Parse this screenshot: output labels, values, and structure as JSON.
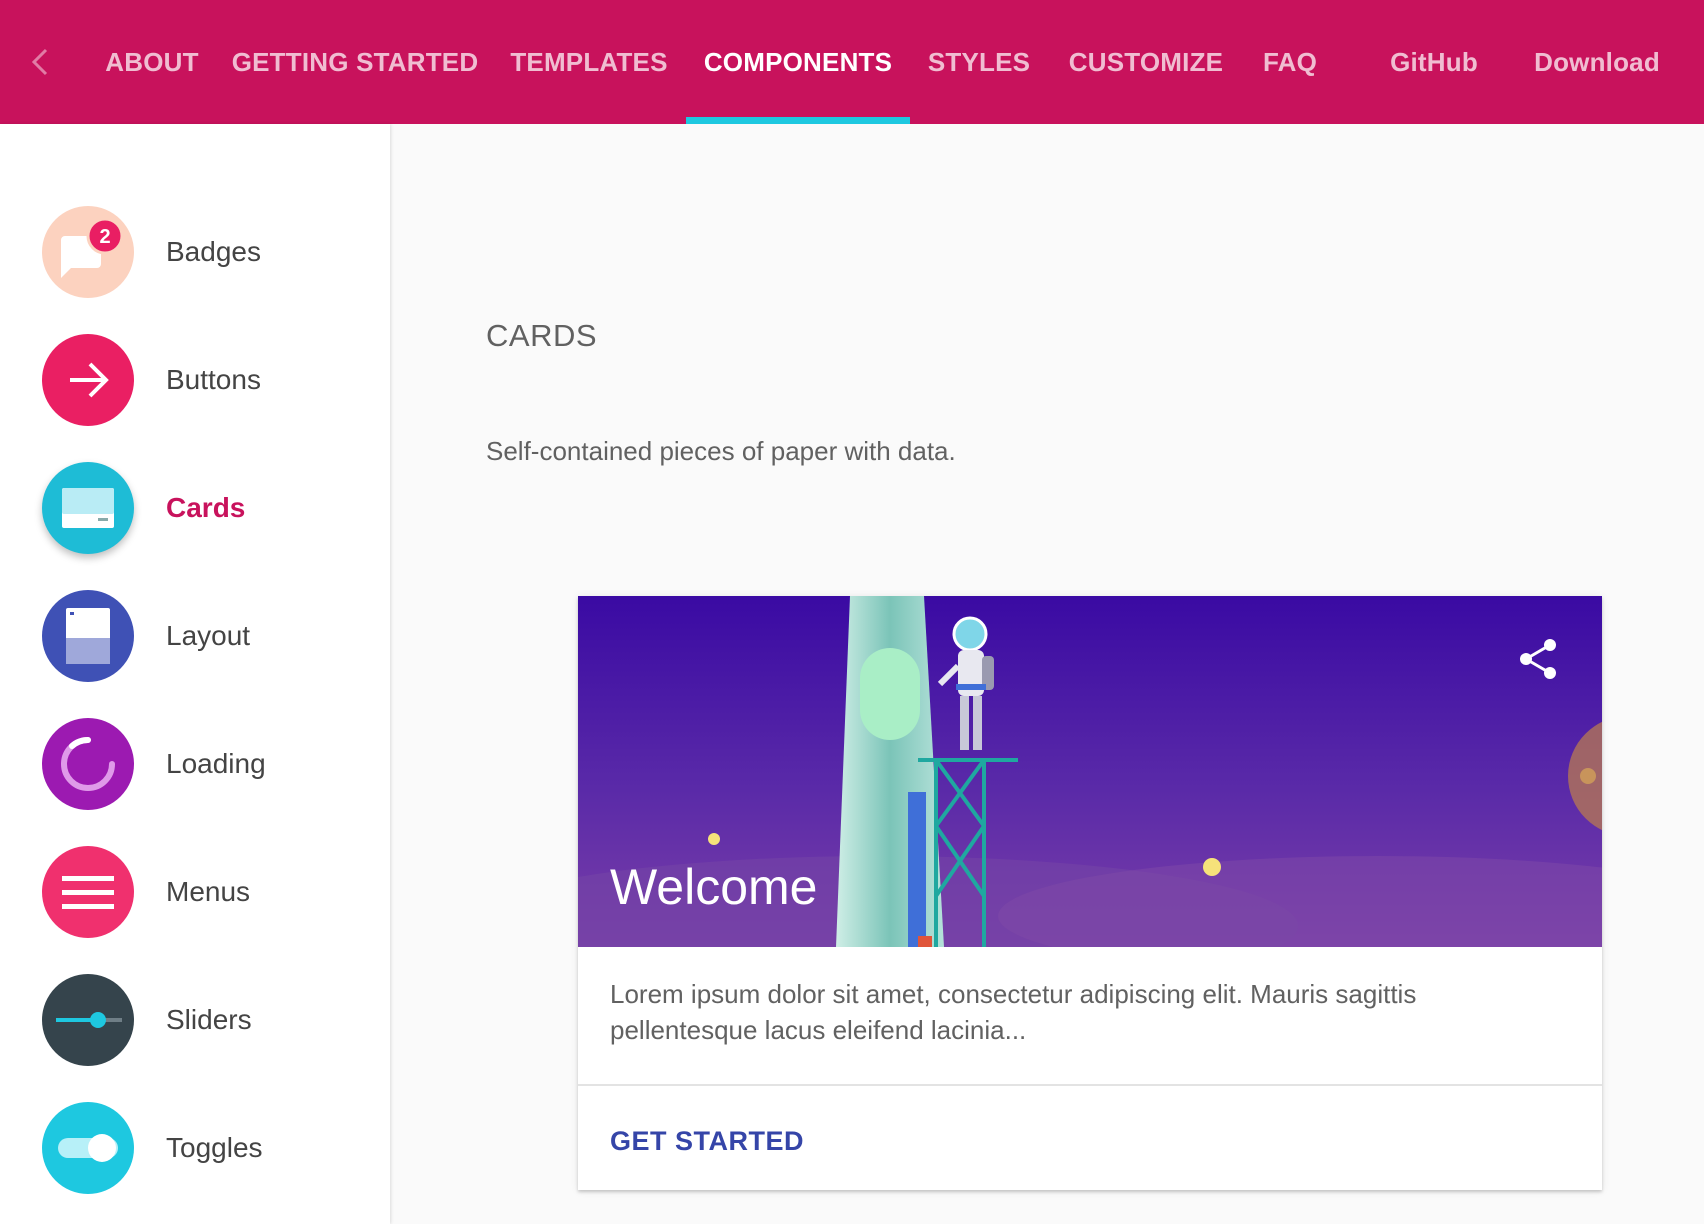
{
  "nav": {
    "items": [
      {
        "label": "ABOUT",
        "active": false
      },
      {
        "label": "GETTING STARTED",
        "active": false
      },
      {
        "label": "TEMPLATES",
        "active": false
      },
      {
        "label": "COMPONENTS",
        "active": true
      },
      {
        "label": "STYLES",
        "active": false
      },
      {
        "label": "CUSTOMIZE",
        "active": false
      },
      {
        "label": "FAQ",
        "active": false
      },
      {
        "label": "GitHub",
        "active": false
      },
      {
        "label": "Download",
        "active": false
      }
    ]
  },
  "sidebar": {
    "items": [
      {
        "label": "Badges",
        "icon": "badge-chat-icon",
        "badge_count": "2",
        "color": "#fcd2bf",
        "active": false
      },
      {
        "label": "Buttons",
        "icon": "arrow-right-icon",
        "color": "#ea1f63",
        "active": false
      },
      {
        "label": "Cards",
        "icon": "card-icon",
        "color": "#1ebcd6",
        "active": true
      },
      {
        "label": "Layout",
        "icon": "layout-icon",
        "color": "#3f51b5",
        "active": false
      },
      {
        "label": "Loading",
        "icon": "spinner-icon",
        "color": "#9c1ab1",
        "active": false
      },
      {
        "label": "Menus",
        "icon": "menu-lines-icon",
        "color": "#f0306e",
        "active": false
      },
      {
        "label": "Sliders",
        "icon": "slider-icon",
        "color": "#35444c",
        "active": false
      },
      {
        "label": "Toggles",
        "icon": "toggle-icon",
        "color": "#1ec8e0",
        "active": false
      }
    ]
  },
  "main": {
    "title": "CARDS",
    "description": "Self-contained pieces of paper with data."
  },
  "card": {
    "title": "Welcome",
    "text": "Lorem ipsum dolor sit amet, consectetur adipiscing elit. Mauris sagittis pellentesque lacus eleifend lacinia...",
    "action_label": "GET STARTED"
  },
  "colors": {
    "primary": "#c8125c",
    "accent": "#1ec8e0",
    "action": "#3545a8"
  }
}
